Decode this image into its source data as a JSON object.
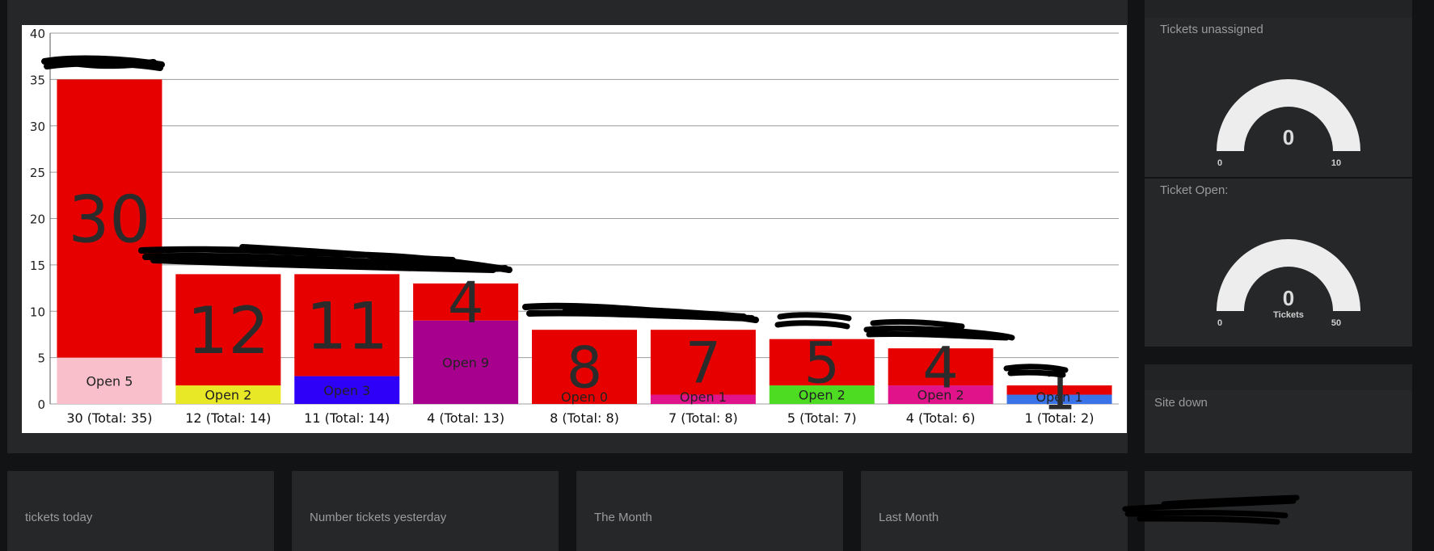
{
  "chart_data": {
    "type": "bar",
    "stacked": true,
    "ylim": [
      0,
      40
    ],
    "yticks": [
      0,
      5,
      10,
      15,
      20,
      25,
      30,
      35,
      40
    ],
    "grid": true,
    "categories": [
      "30 (Total: 35)",
      "12 (Total: 14)",
      "11 (Total: 14)",
      "4 (Total: 13)",
      "8 (Total: 8)",
      "7 (Total: 8)",
      "5 (Total: 7)",
      "4 (Total: 6)",
      "1 (Total: 2)"
    ],
    "series": [
      {
        "values": [
          5,
          2,
          3,
          9,
          0,
          1,
          2,
          2,
          1
        ],
        "labels": [
          "Open 5",
          "Open 2",
          "Open 3",
          "Open 9",
          "Open 0",
          "Open 1",
          "Open 2",
          "Open 2",
          "Open 1"
        ],
        "colors": [
          "#f9c0cb",
          "#e8e827",
          "#2e00f8",
          "#a8008e",
          "#e60000",
          "#e0138a",
          "#4ddc22",
          "#e0138a",
          "#3a72e8"
        ]
      },
      {
        "values": [
          30,
          12,
          11,
          4,
          8,
          7,
          5,
          4,
          1
        ],
        "labels": [
          "30",
          "12",
          "11",
          "4",
          "8",
          "7",
          "5",
          "4",
          "1"
        ],
        "color": "#e60000"
      }
    ]
  },
  "gauges": [
    {
      "title": "Tickets unassigned",
      "value": "0",
      "min": "0",
      "max": "10",
      "unit": "",
      "fraction": 0
    },
    {
      "title": "Ticket Open:",
      "value": "0",
      "min": "0",
      "max": "50",
      "unit": "Tickets",
      "fraction": 0
    }
  ],
  "site_down": {
    "title": "Site down"
  },
  "stats": [
    {
      "title": "tickets today"
    },
    {
      "title": "Number tickets yesterday"
    },
    {
      "title": "The Month"
    },
    {
      "title": "Last Month"
    }
  ],
  "colors": {
    "page_bg": "#121314",
    "panel_bg": "#262728",
    "bar_total": "#e60000",
    "gauge_track": "#ededed"
  }
}
